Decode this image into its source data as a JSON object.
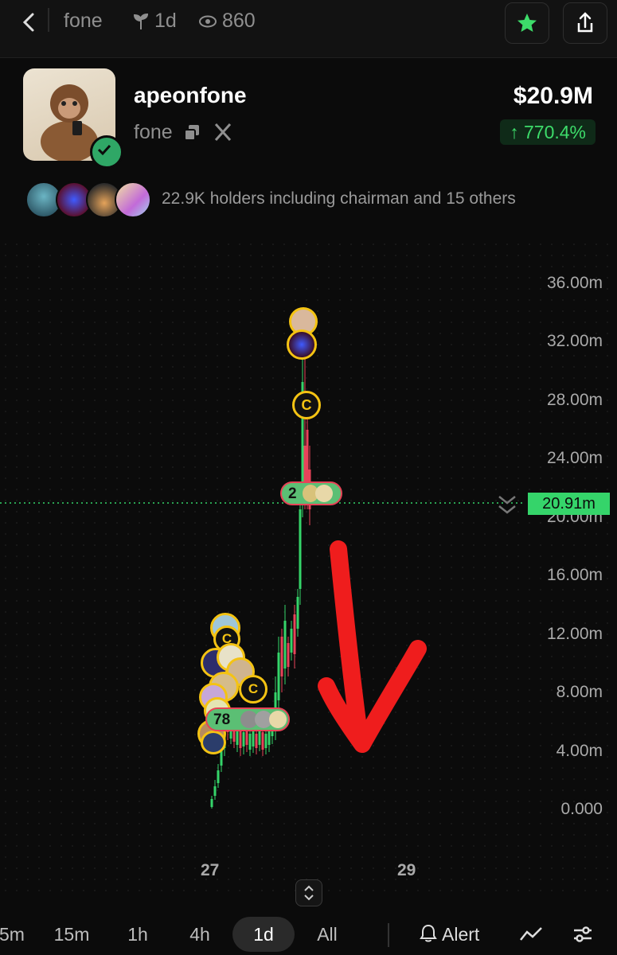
{
  "topbar": {
    "back_icon": "chevron-left-icon",
    "breadcrumb_name": "fone",
    "age": "1d",
    "views": "860",
    "star_icon": "star-icon",
    "share_icon": "share-icon"
  },
  "token": {
    "name": "apeonfone",
    "ticker": "fone",
    "market_cap": "$20.9M",
    "change": "↑ 770.4%"
  },
  "holders": {
    "text": "22.9K holders including chairman and 15 others"
  },
  "chart": {
    "y_labels": [
      "36.00m",
      "32.00m",
      "28.00m",
      "24.00m",
      "20.00m",
      "16.00m",
      "12.00m",
      "8.00m",
      "4.00m",
      "0.000"
    ],
    "x_labels": [
      "27",
      "29"
    ],
    "current_price": "20.91m",
    "cluster_top_count": "2",
    "cluster_bottom_count": "78",
    "marker_letter": "C",
    "colors": {
      "up": "#35d46a",
      "down": "#e8435a",
      "marker": "#f4c313",
      "annotation_arrow": "#ef1d1d"
    }
  },
  "timeframes": [
    "5m",
    "15m",
    "1h",
    "4h",
    "1d",
    "All"
  ],
  "active_timeframe": "1d",
  "alert_label": "Alert"
}
